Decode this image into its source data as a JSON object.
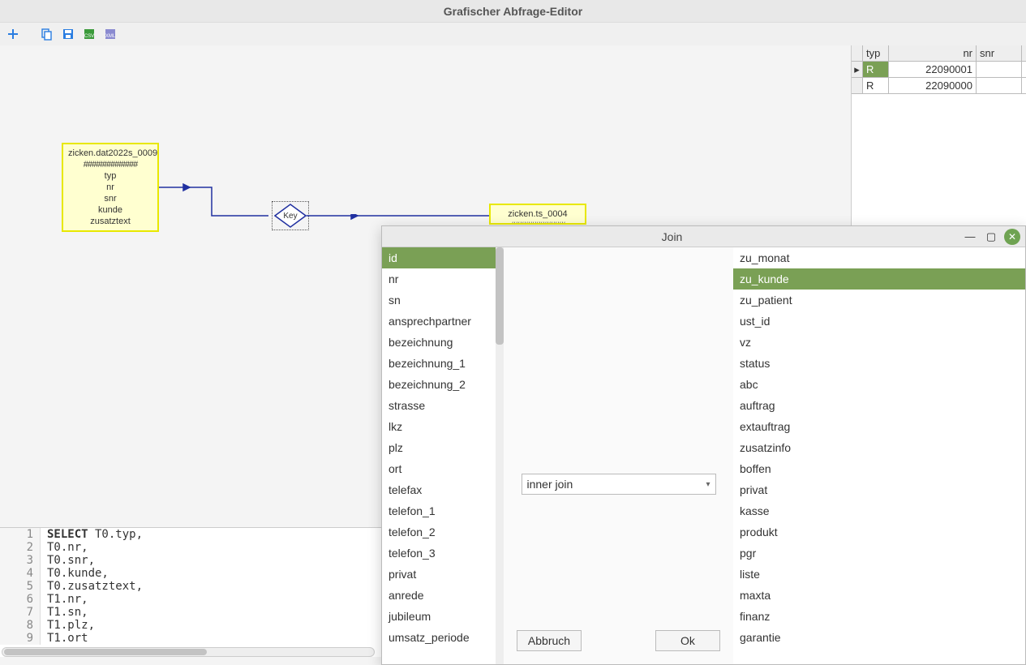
{
  "window": {
    "title": "Grafischer Abfrage-Editor"
  },
  "toolbar": {
    "icons": [
      "plus-icon",
      "copy-icon",
      "save-icon",
      "export-csv-icon",
      "export-xml-icon"
    ]
  },
  "canvas": {
    "entity1": {
      "title": "zicken.dat2022s_0009",
      "sep": "#############",
      "fields": [
        "typ",
        "nr",
        "snr",
        "kunde",
        "zusatztext"
      ]
    },
    "key_label": "Key",
    "entity2": {
      "title": "zicken.ts_0004",
      "sep": "#############"
    }
  },
  "results": {
    "headers": [
      "typ",
      "nr",
      "snr"
    ],
    "rows": [
      {
        "typ": "R",
        "nr": "22090001",
        "snr": "",
        "selected": true
      },
      {
        "typ": "R",
        "nr": "22090000",
        "snr": "",
        "selected": false
      }
    ]
  },
  "sql": {
    "lines": [
      "SELECT T0.typ,",
      "T0.nr,",
      "T0.snr,",
      "T0.kunde,",
      "T0.zusatztext,",
      "T1.nr,",
      "T1.sn,",
      "T1.plz,",
      "T1.ort"
    ]
  },
  "join_dialog": {
    "title": "Join",
    "left_fields": [
      "id",
      "nr",
      "sn",
      "ansprechpartner",
      "bezeichnung",
      "bezeichnung_1",
      "bezeichnung_2",
      "strasse",
      "lkz",
      "plz",
      "ort",
      "telefax",
      "telefon_1",
      "telefon_2",
      "telefon_3",
      "privat",
      "anrede",
      "jubileum",
      "umsatz_periode"
    ],
    "left_selected": "id",
    "join_type": "inner join",
    "right_fields": [
      "zu_monat",
      "zu_kunde",
      "zu_patient",
      "ust_id",
      "vz",
      "status",
      "abc",
      "auftrag",
      "extauftrag",
      "zusatzinfo",
      "boffen",
      "privat",
      "kasse",
      "produkt",
      "pgr",
      "liste",
      "maxta",
      "finanz",
      "garantie"
    ],
    "right_selected": "zu_kunde",
    "btn_cancel": "Abbruch",
    "btn_ok": "Ok"
  }
}
